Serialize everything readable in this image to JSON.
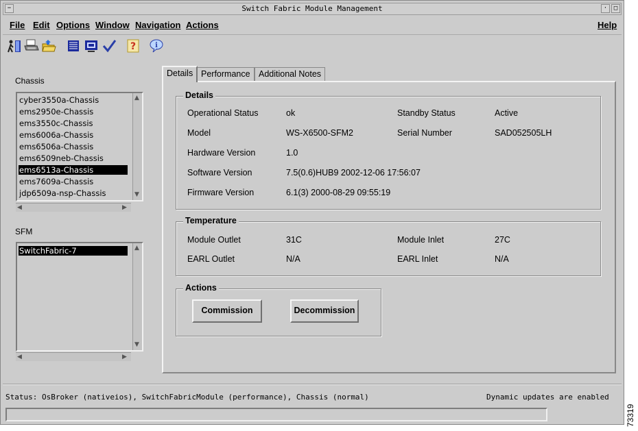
{
  "window": {
    "title": "Switch Fabric Module Management"
  },
  "menubar": {
    "items": [
      {
        "label": "File"
      },
      {
        "label": "Edit"
      },
      {
        "label": "Options"
      },
      {
        "label": "Window"
      },
      {
        "label": "Navigation"
      },
      {
        "label": "Actions"
      }
    ],
    "help_label": "Help"
  },
  "toolbar": {
    "icons": [
      "exit-icon",
      "print-icon",
      "open-folder-icon",
      "list-icon",
      "monitor-icon",
      "checkmark-icon",
      "help-question-icon",
      "info-icon"
    ]
  },
  "chassis": {
    "label": "Chassis",
    "items": [
      "cyber3550a-Chassis",
      "ems2950e-Chassis",
      "ems3550c-Chassis",
      "ems6006a-Chassis",
      "ems6506a-Chassis",
      "ems6509neb-Chassis",
      "ems6513a-Chassis",
      "ems7609a-Chassis",
      "jdp6509a-nsp-Chassis"
    ],
    "selected": "ems6513a-Chassis"
  },
  "sfm": {
    "label": "SFM",
    "items": [
      "SwitchFabric-7"
    ],
    "selected": "SwitchFabric-7"
  },
  "tabs": [
    {
      "label": "Details",
      "active": true
    },
    {
      "label": "Performance",
      "active": false
    },
    {
      "label": "Additional Notes",
      "active": false
    }
  ],
  "details": {
    "title": "Details",
    "operational_status_label": "Operational Status",
    "operational_status": "ok",
    "standby_status_label": "Standby Status",
    "standby_status": "Active",
    "model_label": "Model",
    "model": "WS-X6500-SFM2",
    "serial_number_label": "Serial Number",
    "serial_number": "SAD052505LH",
    "hardware_version_label": "Hardware Version",
    "hardware_version": "1.0",
    "software_version_label": "Software Version",
    "software_version": "7.5(0.6)HUB9 2002-12-06 17:56:07",
    "firmware_version_label": "Firmware Version",
    "firmware_version": "6.1(3) 2000-08-29 09:55:19"
  },
  "temperature": {
    "title": "Temperature",
    "module_outlet_label": "Module Outlet",
    "module_outlet": "31C",
    "module_inlet_label": "Module Inlet",
    "module_inlet": "27C",
    "earl_outlet_label": "EARL Outlet",
    "earl_outlet": "N/A",
    "earl_inlet_label": "EARL Inlet",
    "earl_inlet": "N/A"
  },
  "actions": {
    "title": "Actions",
    "commission_label": "Commission",
    "decommission_label": "Decommission"
  },
  "status": {
    "text": "Status: OsBroker (nativeios), SwitchFabricModule (performance), Chassis (normal)",
    "dynamic": "Dynamic updates are enabled"
  },
  "figure_id": "73319"
}
